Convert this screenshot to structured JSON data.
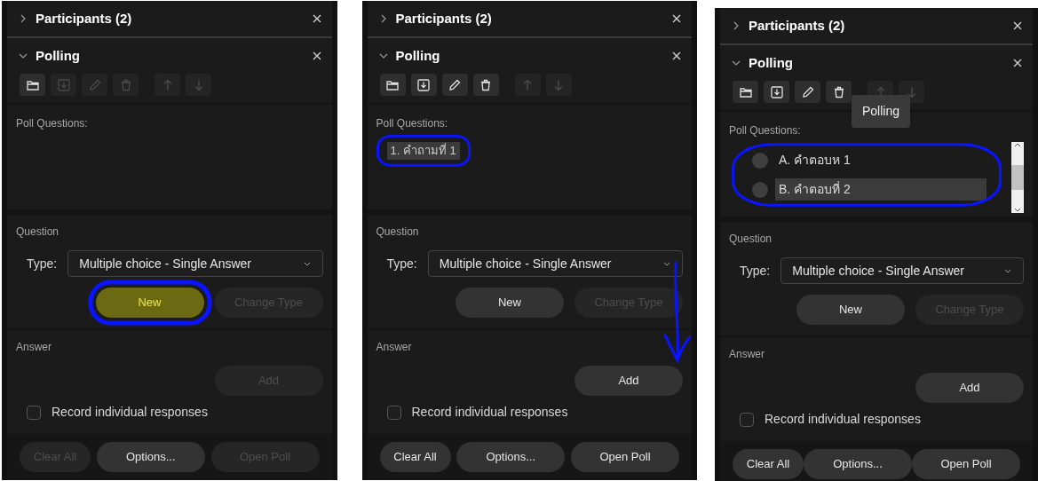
{
  "panels": [
    {
      "participants_title": "Participants (2)",
      "participants_expanded": false,
      "polling_title": "Polling",
      "polling_expanded": true,
      "toolbar": [
        {
          "enabled": true
        },
        {
          "enabled": false
        },
        {
          "enabled": false
        },
        {
          "enabled": false
        },
        {
          "enabled": false
        },
        {
          "enabled": false
        }
      ],
      "questions_label": "Poll Questions:",
      "list_circled": false,
      "question_label": "Question",
      "type_label": "Type:",
      "type_value": "Multiple choice - Single Answer",
      "question_buttons": [
        {
          "label": "New",
          "enabled": true,
          "circled": true,
          "highlighted": true
        },
        {
          "label": "Change Type",
          "enabled": false,
          "circled": false,
          "highlighted": false
        }
      ],
      "answer_label": "Answer",
      "add_button": {
        "label": "Add",
        "enabled": false
      },
      "record": {
        "label": "Record individual responses",
        "checked": false
      },
      "footer_buttons": [
        {
          "label": "Clear All",
          "enabled": false
        },
        {
          "label": "Options...",
          "enabled": true
        },
        {
          "label": "Open Poll",
          "enabled": false
        }
      ]
    },
    {
      "participants_title": "Participants (2)",
      "participants_expanded": false,
      "polling_title": "Polling",
      "polling_expanded": true,
      "toolbar": [
        {
          "enabled": true
        },
        {
          "enabled": true
        },
        {
          "enabled": true
        },
        {
          "enabled": true
        },
        {
          "enabled": false
        },
        {
          "enabled": false
        }
      ],
      "questions_label": "Poll Questions:",
      "list_circled": true,
      "items": [
        {
          "kind": "question",
          "text": "1.  คำถามที่ 1",
          "selected": true
        }
      ],
      "question_label": "Question",
      "type_label": "Type:",
      "type_value": "Multiple choice - Single Answer",
      "question_buttons": [
        {
          "label": "New",
          "enabled": true,
          "circled": false,
          "highlighted": false
        },
        {
          "label": "Change Type",
          "enabled": false,
          "circled": false,
          "highlighted": false
        }
      ],
      "answer_label": "Answer",
      "add_button": {
        "label": "Add",
        "enabled": true,
        "arrow_drawn": true
      },
      "record": {
        "label": "Record individual responses",
        "checked": false
      },
      "footer_buttons": [
        {
          "label": "Clear All",
          "enabled": true
        },
        {
          "label": "Options...",
          "enabled": true
        },
        {
          "label": "Open Poll",
          "enabled": true
        }
      ]
    },
    {
      "participants_title": "Participants (2)",
      "participants_expanded": false,
      "polling_title": "Polling",
      "polling_expanded": true,
      "toolbar": [
        {
          "enabled": true
        },
        {
          "enabled": true
        },
        {
          "enabled": true
        },
        {
          "enabled": true
        },
        {
          "enabled": false
        },
        {
          "enabled": false
        }
      ],
      "tooltip": "Polling",
      "questions_label": "Poll Questions:",
      "list_circled": true,
      "items": [
        {
          "kind": "answer",
          "text": "A.  คำตอบห 1",
          "selected": false,
          "checked": false
        },
        {
          "kind": "answer",
          "text": "B.  คำตอบที่ 2",
          "selected": true,
          "checked": false
        }
      ],
      "question_label": "Question",
      "type_label": "Type:",
      "type_value": "Multiple choice - Single Answer",
      "question_buttons": [
        {
          "label": "New",
          "enabled": true,
          "circled": false,
          "highlighted": false
        },
        {
          "label": "Change Type",
          "enabled": false,
          "circled": false,
          "highlighted": false
        }
      ],
      "answer_label": "Answer",
      "add_button": {
        "label": "Add",
        "enabled": true
      },
      "record": {
        "label": "Record individual responses",
        "checked": false
      },
      "footer_buttons": [
        {
          "label": "Clear All",
          "enabled": true
        },
        {
          "label": "Options...",
          "enabled": true
        },
        {
          "label": "Open Poll",
          "enabled": true
        }
      ]
    }
  ]
}
